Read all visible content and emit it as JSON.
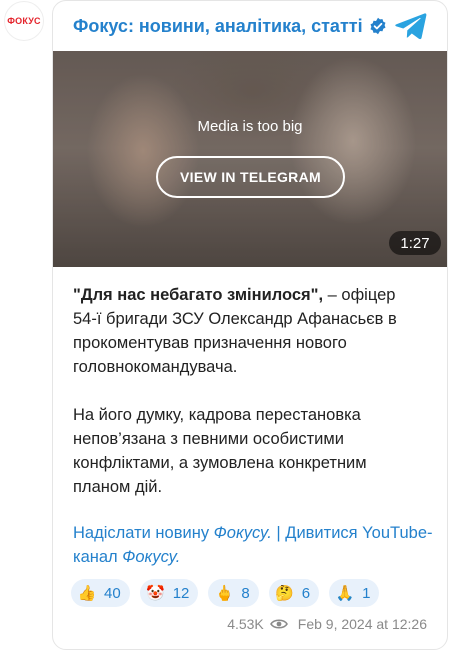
{
  "channel": {
    "name": "Фокус: новини, аналітика, статті",
    "avatar_text": "ФОКУС",
    "accent_color": "#2481cc",
    "logo_color": "#e4232b"
  },
  "media": {
    "notice": "Media is too big",
    "button_label": "VIEW IN TELEGRAM",
    "duration": "1:27"
  },
  "post": {
    "quote": "\"Для нас небагато змінилося\",",
    "p1_rest": " – офіцер 54-ї бригади ЗСУ Олександр Афанасьєв в прокоментував призначення нового головнокомандувача.",
    "p2": "На його думку, кадрова перестановка непов’язана з певними особистими конфліктами, а зумовлена конкретним планом дій."
  },
  "links": {
    "send_prefix": "Надіслати новину ",
    "send_italic": "Фокусу.",
    "separator": " | ",
    "watch_prefix": "Дивитися YouTube-канал ",
    "watch_italic": "Фокусу."
  },
  "reactions": [
    {
      "icon": "thumbs-up-icon",
      "emoji": "👍",
      "count": "40"
    },
    {
      "icon": "clown-face-icon",
      "emoji": "🤡",
      "count": "12"
    },
    {
      "icon": "middle-finger-icon",
      "emoji": "🖕",
      "count": "8"
    },
    {
      "icon": "thinking-face-icon",
      "emoji": "🤔",
      "count": "6"
    },
    {
      "icon": "folded-hands-icon",
      "emoji": "🙏",
      "count": "1"
    }
  ],
  "meta": {
    "views": "4.53K",
    "date": "Feb 9, 2024 at 12:26"
  }
}
